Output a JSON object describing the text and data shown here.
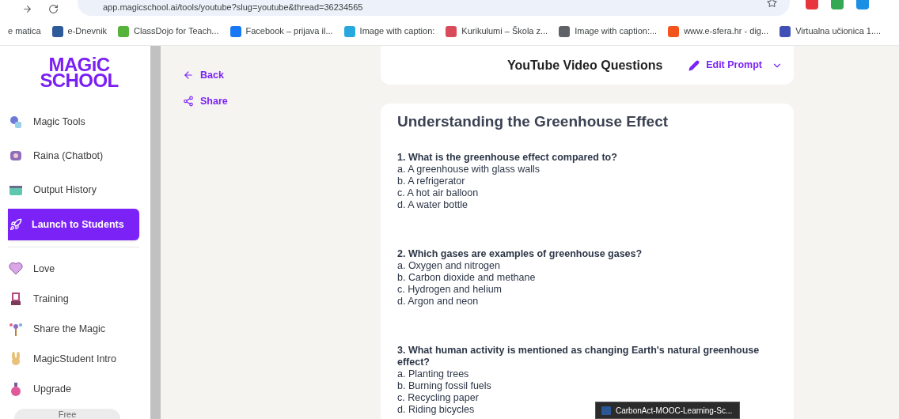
{
  "browser": {
    "url": "app.magicschool.ai/tools/youtube?slug=youtube&thread=36234565",
    "bookmarks": [
      {
        "label": "e matica"
      },
      {
        "label": "e-Dnevnik"
      },
      {
        "label": "ClassDojo for Teach..."
      },
      {
        "label": "Facebook – prijava il..."
      },
      {
        "label": "Image with caption:"
      },
      {
        "label": "Kurikulumi – Škola z..."
      },
      {
        "label": "Image with caption:..."
      },
      {
        "label": "www.e-sfera.hr - dig..."
      },
      {
        "label": "Virtualna učionica 1...."
      }
    ]
  },
  "sidebar": {
    "logo": [
      "MAGiC",
      "SCHOOL"
    ],
    "items": [
      {
        "label": "Magic Tools",
        "selected": false
      },
      {
        "label": "Raina (Chatbot)",
        "selected": false
      },
      {
        "label": "Output History",
        "selected": false
      },
      {
        "label": "Launch to Students",
        "selected": true
      }
    ],
    "more_items": [
      {
        "label": "Love"
      },
      {
        "label": "Training"
      },
      {
        "label": "Share the Magic"
      },
      {
        "label": "MagicStudent Intro"
      },
      {
        "label": "Upgrade"
      }
    ],
    "plan_button": "Free"
  },
  "actions": [
    "Back",
    "Share"
  ],
  "header": {
    "title": "YouTube Video Questions",
    "edit_prompt": "Edit Prompt"
  },
  "output": {
    "title": "Understanding the Greenhouse Effect",
    "questions": [
      {
        "question": "1. What is the greenhouse effect compared to?",
        "options": [
          "a. A greenhouse with glass walls",
          "b. A refrigerator",
          "c. A hot air balloon",
          "d. A water bottle"
        ]
      },
      {
        "question": "2. Which gases are examples of greenhouse gases?",
        "options": [
          "a. Oxygen and nitrogen",
          "b. Carbon dioxide and methane",
          "c. Hydrogen and helium",
          "d. Argon and neon"
        ]
      },
      {
        "question": "3. What human activity is mentioned as changing Earth's natural greenhouse effect?",
        "options": [
          "a. Planting trees",
          "b. Burning fossil fuels",
          "c. Recycling paper",
          "d. Riding bicycles"
        ]
      }
    ]
  },
  "taskbar_preview": {
    "label": "CarbonAct-MOOC-Learning-Sc..."
  }
}
